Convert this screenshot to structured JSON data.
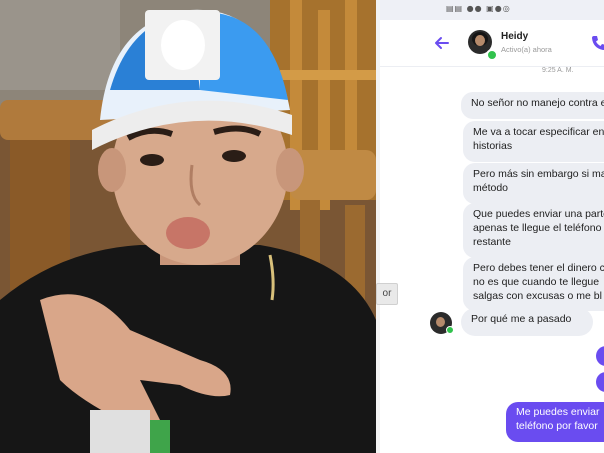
{
  "status_bar": {
    "icons": "▤▤ ●● ▣●◎"
  },
  "header": {
    "contact_name": "Heidy",
    "contact_status": "Activo(a) ahora",
    "back_icon": "arrow-left-icon",
    "call_icon": "phone-icon"
  },
  "conversation": {
    "timestamp": "9:25 A. M.",
    "received": [
      [
        "No señor no manejo contra e"
      ],
      [
        "Me va a tocar especificar en",
        "historias"
      ],
      [
        "Pero más sin embargo si ma",
        "método"
      ],
      [
        "Que puedes enviar una parte",
        "apenas te llegue el teléfono",
        "restante"
      ],
      [
        "Pero debes tener el dinero c",
        "no es que cuando te llegue",
        "salgas con excusas o me bl"
      ],
      [
        "Por qué me a pasado"
      ]
    ],
    "sent": [
      "Me puedes enviar",
      "teléfono por favor"
    ]
  },
  "photo_overlay_text": "or",
  "colors": {
    "accent": "#6a4cf0",
    "received_bubble": "#eceef3",
    "online": "#31c24d"
  }
}
